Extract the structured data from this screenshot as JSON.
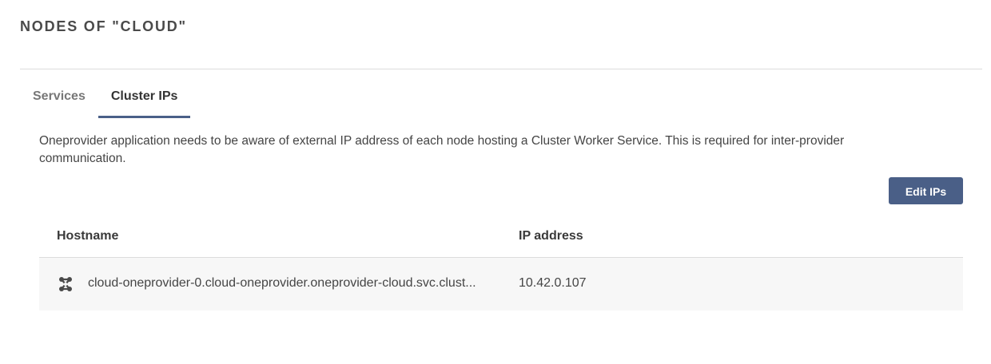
{
  "page": {
    "title": "NODES OF \"CLOUD\""
  },
  "tabs": [
    {
      "label": "Services",
      "active": false
    },
    {
      "label": "Cluster IPs",
      "active": true
    }
  ],
  "description": "Oneprovider application needs to be aware of external IP address of each node hosting a Cluster Worker Service. This is required for inter-provider communication.",
  "actions": {
    "edit_ips_label": "Edit IPs"
  },
  "table": {
    "columns": [
      "Hostname",
      "IP address"
    ],
    "rows": [
      {
        "icon": "cluster-node-icon",
        "hostname": "cloud-oneprovider-0.cloud-oneprovider.oneprovider-cloud.svc.clust...",
        "ip": "10.42.0.107"
      }
    ]
  },
  "colors": {
    "accent": "#4a5f87",
    "tab_underline": "#4a6088",
    "row_bg": "#f7f7f7",
    "divider": "#dcdcdc"
  }
}
